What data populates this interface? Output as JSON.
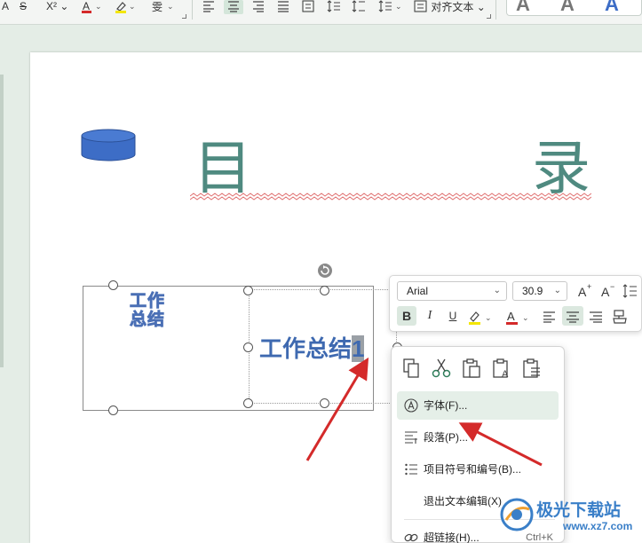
{
  "ribbon": {
    "superscript": "X²",
    "align_label": "对齐文本",
    "style_letters": [
      "A",
      "A",
      "A"
    ]
  },
  "slide": {
    "title_left": "目",
    "title_right": "录",
    "wordart_text": "工作总结",
    "main_text": "工作总结",
    "selected_char": "1"
  },
  "mini_toolbar": {
    "font": "Arial",
    "size": "30.9"
  },
  "context_menu": {
    "items": [
      {
        "label": "字体(F)..."
      },
      {
        "label": "段落(P)..."
      },
      {
        "label": "项目符号和编号(B)..."
      },
      {
        "label": "退出文本编辑(X)"
      },
      {
        "label": "超链接(H)...",
        "shortcut": "Ctrl+K"
      }
    ]
  },
  "watermark": {
    "name": "极光下载站",
    "url": "www.xz7.com"
  },
  "colors": {
    "accent": "#4f8a80",
    "text_blue": "#3e69b0",
    "arrow_red": "#d42a2a",
    "shape_blue": "#3d6dc6"
  }
}
